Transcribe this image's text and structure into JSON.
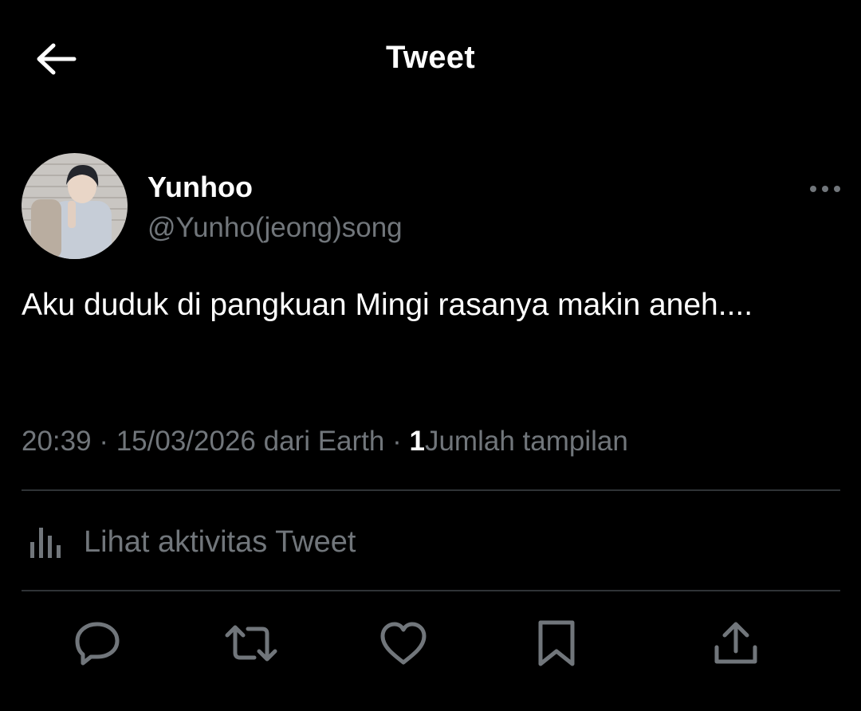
{
  "header": {
    "title": "Tweet",
    "back_icon": "arrow-left-icon"
  },
  "author": {
    "name": "Yunhoo",
    "handle": "@Yunho(jeong)song",
    "more_icon": "more-horizontal-icon"
  },
  "tweet": {
    "text": "Aku duduk di pangkuan Mingi rasanya makin aneh....",
    "time": "20:39",
    "date": "15/03/2026",
    "source": "dari Earth",
    "separator": "·",
    "views_count": "1",
    "views_label": "Jumlah tampilan"
  },
  "activity": {
    "label": "Lihat aktivitas Tweet",
    "icon": "analytics-bars-icon"
  },
  "actions": [
    {
      "name": "reply",
      "icon": "reply-icon"
    },
    {
      "name": "retweet",
      "icon": "retweet-icon"
    },
    {
      "name": "like",
      "icon": "heart-icon"
    },
    {
      "name": "bookmark",
      "icon": "bookmark-icon"
    },
    {
      "name": "share",
      "icon": "share-icon"
    }
  ],
  "colors": {
    "background": "#000000",
    "primary_text": "#ffffff",
    "secondary_text": "#71767b",
    "divider": "#2f3336"
  }
}
